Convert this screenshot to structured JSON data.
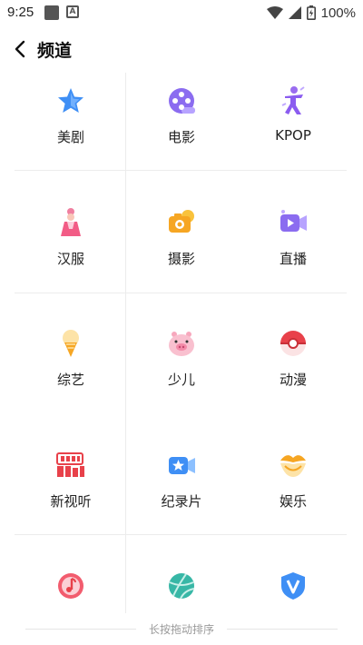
{
  "status_bar": {
    "time": "9:25",
    "battery": "100%"
  },
  "header": {
    "title": "频道"
  },
  "channels": [
    {
      "label": "美剧",
      "icon": "star-icon"
    },
    {
      "label": "电影",
      "icon": "film-reel-icon"
    },
    {
      "label": "KPOP",
      "icon": "dancer-icon"
    },
    {
      "label": "汉服",
      "icon": "hanfu-figure-icon"
    },
    {
      "label": "摄影",
      "icon": "camera-icon"
    },
    {
      "label": "直播",
      "icon": "video-camera-icon"
    },
    {
      "label": "综艺",
      "icon": "ice-cream-icon"
    },
    {
      "label": "少儿",
      "icon": "pig-icon"
    },
    {
      "label": "动漫",
      "icon": "pokeball-icon"
    },
    {
      "label": "新视听",
      "icon": "new-era-logo-icon"
    },
    {
      "label": "纪录片",
      "icon": "documentary-camera-icon"
    },
    {
      "label": "娱乐",
      "icon": "lips-icon"
    },
    {
      "label": "",
      "icon": "music-note-icon"
    },
    {
      "label": "",
      "icon": "sports-ball-icon"
    },
    {
      "label": "",
      "icon": "v-shield-icon"
    }
  ],
  "footer": {
    "hint": "长按拖动排序"
  },
  "colors": {
    "accent_purple": "#8b6cf0",
    "accent_orange": "#f6a623",
    "accent_red": "#e8414a",
    "accent_blue": "#3f8ff5"
  }
}
